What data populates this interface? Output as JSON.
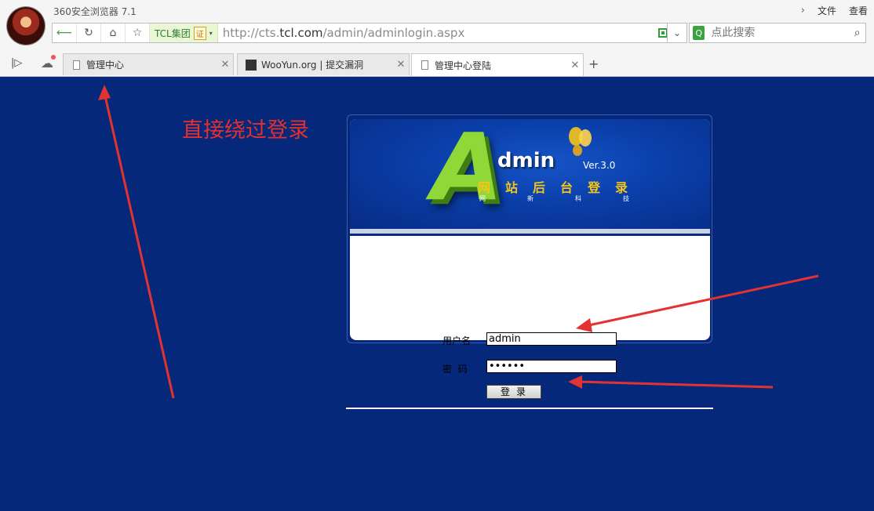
{
  "browser": {
    "title": "360安全浏览器 7.1",
    "menu": {
      "file": "文件",
      "view": "查看"
    },
    "cert_label": "TCL集团",
    "cert_seal": "证",
    "url_prefix": "http://cts.",
    "url_domain": "tcl.com",
    "url_path": "/admin/adminlogin.aspx",
    "search_placeholder": "点此搜索",
    "tabs": [
      {
        "title": "管理中心",
        "active": false
      },
      {
        "title": "WooYun.org | 提交漏洞",
        "active": false
      },
      {
        "title": "管理中心登陆",
        "active": true
      }
    ]
  },
  "page": {
    "annotation": "直接绕过登录",
    "logo_big": "A",
    "logo_rest": "dmin",
    "version": "Ver.3.0",
    "subtitle": "网站后台登录",
    "subtitle_small": [
      "网",
      "新",
      "科",
      "技"
    ],
    "username_label": "用户名",
    "username_value": "admin",
    "password_label": "密  码",
    "password_value": "••••••",
    "login_button": "登录"
  },
  "colors": {
    "page_bg": "#06287a",
    "annotation": "#e2302e",
    "logo_green": "#8fd838",
    "subtitle_gold": "#f5c518"
  }
}
